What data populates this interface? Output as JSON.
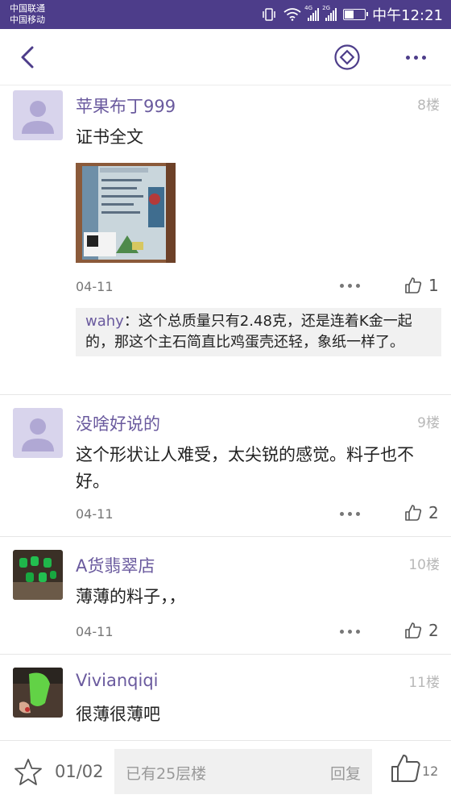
{
  "status": {
    "carrier1": "中国联通",
    "carrier2": "中国移动",
    "net1": "4G",
    "net2": "2G",
    "time": "中午12:21"
  },
  "nav": {
    "back_icon": "chevron-left-icon",
    "center_icon": "diamond-icon",
    "more_icon": "more-icon"
  },
  "posts": [
    {
      "username": "苹果布丁999",
      "floor": "8楼",
      "content": "证书全文",
      "date": "04-11",
      "likes": "1",
      "reply": {
        "user": "wahy",
        "text": "：这个总质量只有2.48克，还是连着K金一起的，那这个主石简直比鸡蛋壳还轻，象纸一样了。"
      }
    },
    {
      "username": "没啥好说的",
      "floor": "9楼",
      "content": "这个形状让人难受，太尖锐的感觉。料子也不好。",
      "date": "04-11",
      "likes": "2"
    },
    {
      "username": "A货翡翠店",
      "floor": "10楼",
      "content": "薄薄的料子，，",
      "date": "04-11",
      "likes": "2"
    },
    {
      "username": "Vivianqiqi",
      "floor": "11楼",
      "content": "很薄很薄吧"
    }
  ],
  "bottom": {
    "pager": "01/02",
    "placeholder": "已有25层楼",
    "reply_label": "回复",
    "likes": "12"
  },
  "colors": {
    "accent": "#4d3d8a",
    "username": "#6a5a9e"
  }
}
